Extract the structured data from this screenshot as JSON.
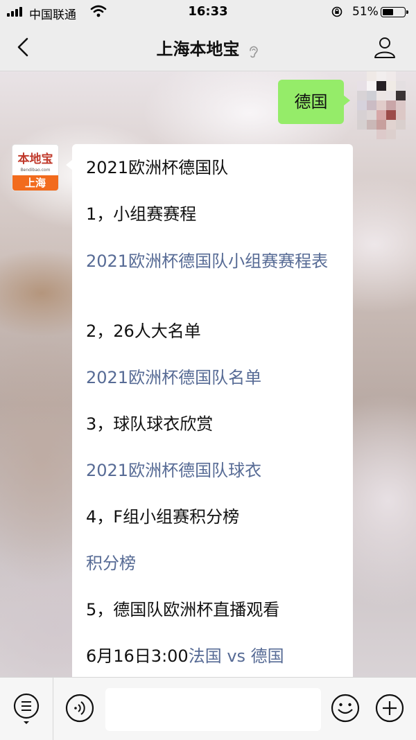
{
  "status_bar": {
    "carrier": "中国联通",
    "time": "16:33",
    "battery": "51%",
    "battery_level": 0.51
  },
  "header": {
    "title": "上海本地宝"
  },
  "chat": {
    "sent_message": "德国",
    "official_avatar": {
      "main": "本地宝",
      "sub": "Bendibao.com",
      "city": "上海"
    },
    "reply_lines": [
      {
        "text": "2021欧洲杯德国队",
        "link": false
      },
      {
        "text": "1，小组赛赛程",
        "link": false
      },
      {
        "text": "2021欧洲杯德国队小组赛赛程表",
        "link": true
      },
      {
        "text": "2，26人大名单",
        "link": false
      },
      {
        "text": "2021欧洲杯德国队名单",
        "link": true
      },
      {
        "text": "3，球队球衣欣赏",
        "link": false
      },
      {
        "text": "2021欧洲杯德国队球衣",
        "link": true
      },
      {
        "text": "4，F组小组赛积分榜",
        "link": false
      },
      {
        "text": "积分榜",
        "link": true
      },
      {
        "text": "5，德国队欧洲杯直播观看",
        "link": false
      }
    ],
    "last_line": {
      "time_text": "6月16日3:00",
      "link_text": "法国 vs 德国"
    }
  },
  "input_bar": {
    "placeholder": ""
  },
  "colors": {
    "sent_bubble": "#95ec69",
    "link": "#576b95",
    "bar_bg": "#ededed"
  },
  "icons": [
    "back-icon",
    "ear-icon",
    "profile-icon",
    "menu-icon",
    "voice-icon",
    "emoji-icon",
    "plus-icon"
  ]
}
